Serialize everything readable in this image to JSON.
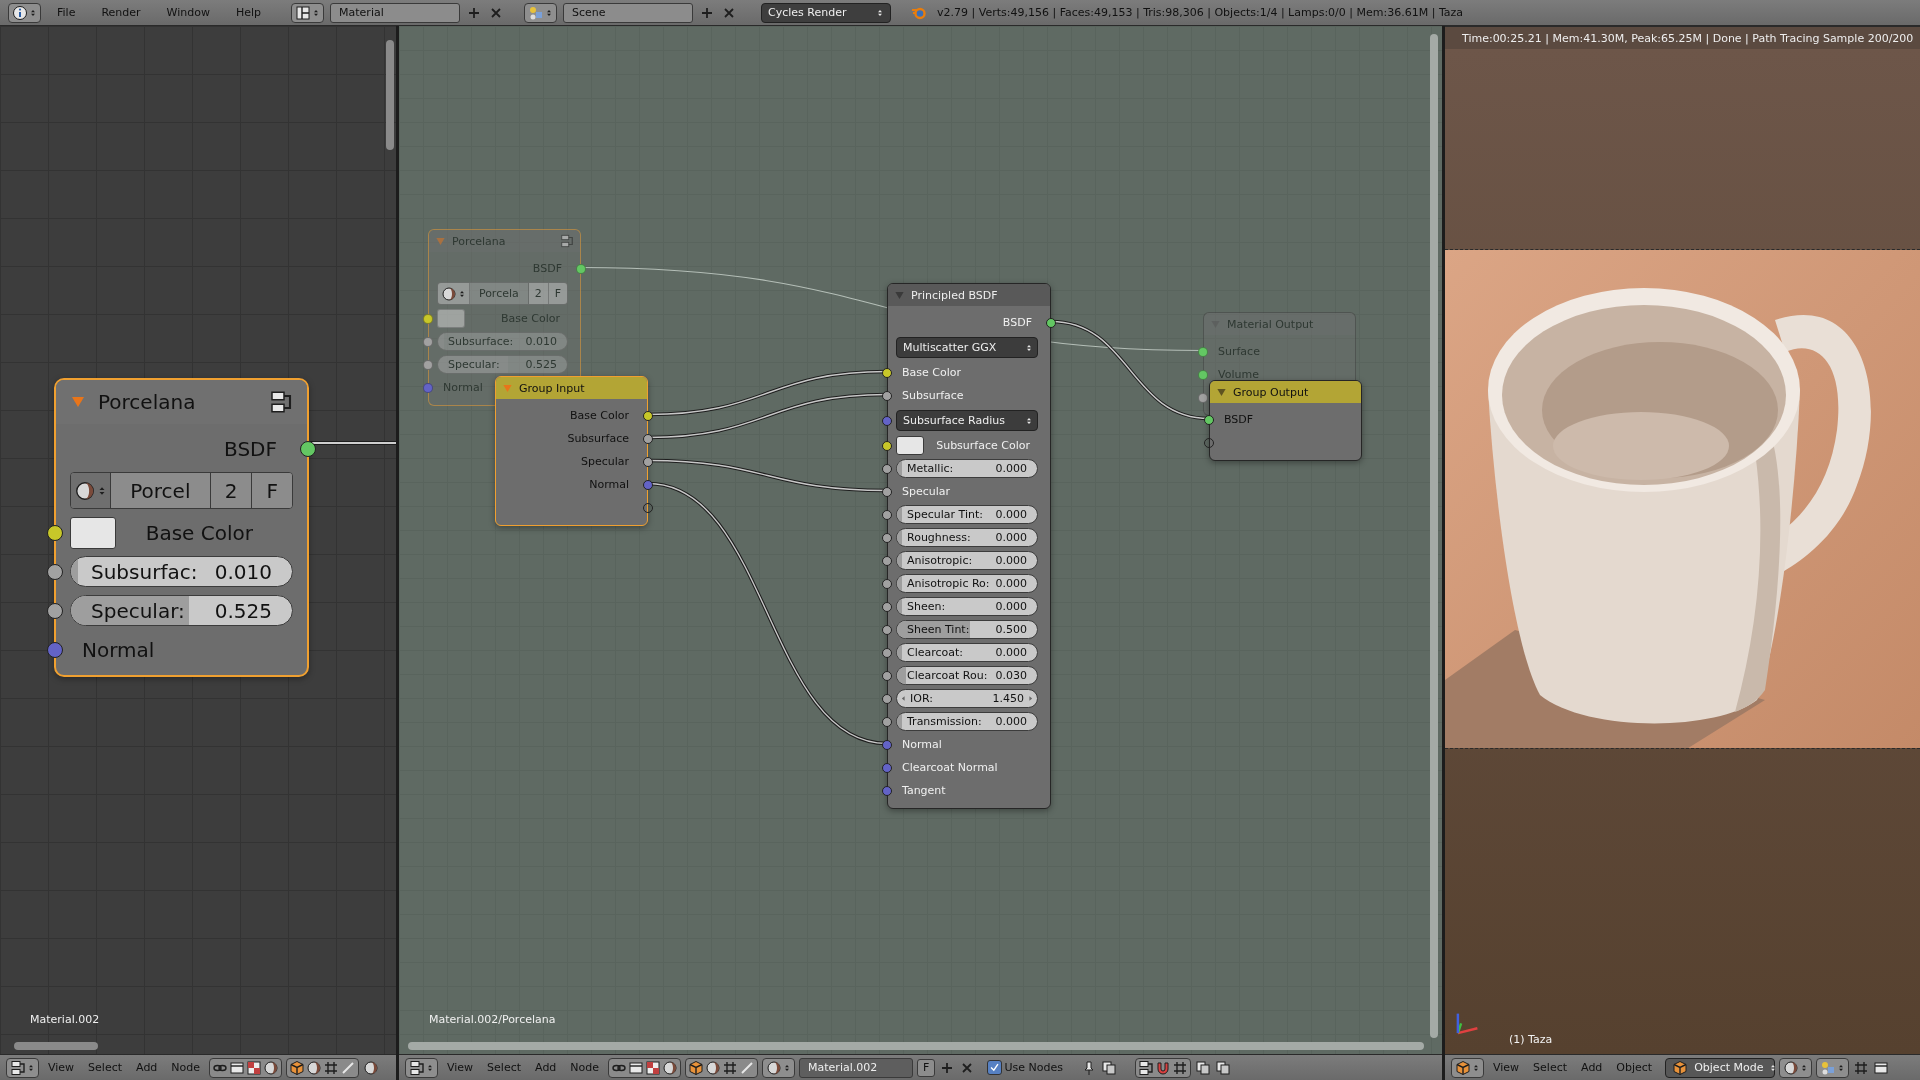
{
  "top_bar": {
    "menus": [
      "File",
      "Render",
      "Window",
      "Help"
    ],
    "screen_layout": "Material",
    "scene": "Scene",
    "render_engine": "Cycles Render",
    "stats": "v2.79 | Verts:49,156 | Faces:49,153 | Tris:98,306 | Objects:1/4 | Lamps:0/0 | Mem:36.61M | Taza"
  },
  "left_editor": {
    "node": {
      "kind": "group",
      "title": "Porcelana",
      "selected": true,
      "rows": [
        {
          "kind": "output",
          "label": "BSDF",
          "color": "#63c763"
        },
        {
          "kind": "datablock",
          "name": "Porcel",
          "users": "2",
          "fake_user": "F"
        },
        {
          "kind": "color",
          "label": "Base Color",
          "color": "#c7c729"
        },
        {
          "kind": "slider",
          "label": "Subsurfac:",
          "value": "0.010",
          "level": 0.01,
          "color": "#a1a1a1"
        },
        {
          "kind": "slider",
          "label": "Specular:",
          "value": "0.525",
          "level": 0.525,
          "color": "#a1a1a1"
        },
        {
          "kind": "input",
          "label": "Normal",
          "color": "#6363c7"
        }
      ]
    },
    "footer": "Material.002",
    "header": {
      "menus": [
        "View",
        "Select",
        "Add",
        "Node"
      ]
    }
  },
  "node_editor": {
    "nodes": [
      {
        "kind": "group",
        "title": "Porcelana",
        "selected": true,
        "background": true,
        "rows": [
          {
            "kind": "output",
            "label": "BSDF",
            "color": "#63c763"
          },
          {
            "kind": "datablock",
            "name": "Porcela",
            "users": "2",
            "fake_user": "F"
          },
          {
            "kind": "color",
            "label": "Base Color",
            "color": "#c7c729"
          },
          {
            "kind": "slider",
            "label": "Subsurface:",
            "value": "0.010",
            "level": 0.01,
            "color": "#a1a1a1"
          },
          {
            "kind": "slider",
            "label": "Specular:",
            "value": "0.525",
            "level": 0.525,
            "color": "#a1a1a1"
          },
          {
            "kind": "input",
            "label": "Normal",
            "color": "#6363c7"
          }
        ]
      },
      {
        "kind": "output",
        "title": "Material Output",
        "selected": false,
        "background": true,
        "rows": [
          {
            "kind": "input",
            "label": "Surface",
            "color": "#63c763"
          },
          {
            "kind": "input",
            "label": "Volume",
            "color": "#63c763"
          },
          {
            "kind": "input",
            "color": "#a1a1a1"
          }
        ]
      },
      {
        "kind": "group_input",
        "title": "Group Input",
        "selected": true,
        "background": false,
        "rows": [
          {
            "kind": "output",
            "label": "Base Color",
            "color": "#c7c729"
          },
          {
            "kind": "output",
            "label": "Subsurface",
            "color": "#a1a1a1"
          },
          {
            "kind": "output",
            "label": "Specular",
            "color": "#a1a1a1"
          },
          {
            "kind": "output",
            "label": "Normal",
            "color": "#6363c7"
          },
          {
            "kind": "virtual_output"
          }
        ]
      },
      {
        "kind": "shader",
        "title": "Principled BSDF",
        "selected": false,
        "background": false,
        "rows": [
          {
            "kind": "output",
            "label": "BSDF",
            "color": "#63c763"
          },
          {
            "kind": "dropdown",
            "value": "Multiscatter GGX"
          },
          {
            "kind": "input",
            "label": "Base Color",
            "color": "#c7c729"
          },
          {
            "kind": "input",
            "label": "Subsurface",
            "color": "#a1a1a1"
          },
          {
            "kind": "dropdown",
            "value": "Subsurface Radius",
            "color": "#6363c7"
          },
          {
            "kind": "color",
            "label": "Subsurface Color",
            "color": "#c7c729"
          },
          {
            "kind": "slider",
            "label": "Metallic:",
            "value": "0.000",
            "level": 0,
            "color": "#a1a1a1"
          },
          {
            "kind": "input",
            "label": "Specular",
            "color": "#a1a1a1"
          },
          {
            "kind": "slider",
            "label": "Specular Tint:",
            "value": "0.000",
            "level": 0,
            "color": "#a1a1a1"
          },
          {
            "kind": "slider",
            "label": "Roughness:",
            "value": "0.000",
            "level": 0,
            "color": "#a1a1a1"
          },
          {
            "kind": "slider",
            "label": "Anisotropic:",
            "value": "0.000",
            "level": 0,
            "color": "#a1a1a1"
          },
          {
            "kind": "slider",
            "label": "Anisotropic Ro:",
            "value": "0.000",
            "level": 0,
            "color": "#a1a1a1"
          },
          {
            "kind": "slider",
            "label": "Sheen:",
            "value": "0.000",
            "level": 0,
            "color": "#a1a1a1"
          },
          {
            "kind": "slider",
            "label": "Sheen Tint:",
            "value": "0.500",
            "level": 0.5,
            "color": "#a1a1a1"
          },
          {
            "kind": "slider",
            "label": "Clearcoat:",
            "value": "0.000",
            "level": 0,
            "color": "#a1a1a1"
          },
          {
            "kind": "slider",
            "label": "Clearcoat Rou:",
            "value": "0.030",
            "level": 0.03,
            "color": "#a1a1a1"
          },
          {
            "kind": "number",
            "label": "IOR:",
            "value": "1.450",
            "color": "#a1a1a1"
          },
          {
            "kind": "slider",
            "label": "Transmission:",
            "value": "0.000",
            "level": 0,
            "color": "#a1a1a1"
          },
          {
            "kind": "input",
            "label": "Normal",
            "color": "#6363c7"
          },
          {
            "kind": "input",
            "label": "Clearcoat Normal",
            "color": "#6363c7"
          },
          {
            "kind": "input",
            "label": "Tangent",
            "color": "#6363c7"
          }
        ]
      },
      {
        "kind": "group_output",
        "title": "Group Output",
        "selected": false,
        "background": false,
        "rows": [
          {
            "kind": "input",
            "label": "BSDF",
            "color": "#63c763"
          },
          {
            "kind": "virtual_input"
          }
        ]
      }
    ],
    "footer": "Material.002/Porcelana",
    "header": {
      "menus": [
        "View",
        "Select",
        "Add",
        "Node"
      ],
      "material": "Material.002",
      "fake_user": "F",
      "use_nodes": {
        "label": "Use Nodes",
        "checked": true
      }
    }
  },
  "viewport": {
    "status": "Time:00:25.21 | Mem:41.30M, Peak:65.25M | Done | Path Tracing Sample 200/200",
    "object_label": "(1) Taza",
    "header": {
      "menus": [
        "View",
        "Select",
        "Add",
        "Object"
      ],
      "mode": "Object Mode"
    }
  }
}
